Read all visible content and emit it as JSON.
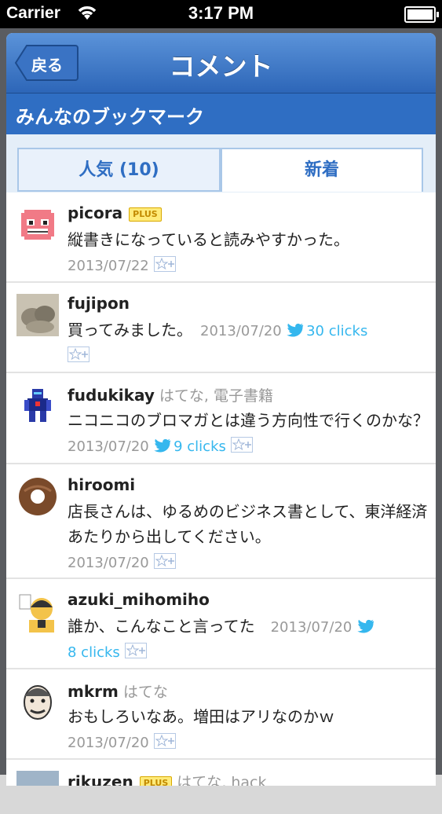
{
  "status_bar": {
    "carrier": "Carrier",
    "time": "3:17 PM"
  },
  "nav": {
    "back_label": "戻る",
    "title": "コメント"
  },
  "section_title": "みんなのブックマーク",
  "tabs": [
    {
      "label": "人気 (10)"
    },
    {
      "label": "新着"
    }
  ],
  "comments": [
    {
      "user": "picora",
      "badge": "PLUS",
      "tags": "",
      "text": "縦書きになっていると読みやすかった。",
      "date": "2013/07/22",
      "clicks": ""
    },
    {
      "user": "fujipon",
      "badge": "",
      "tags": "",
      "text": "買ってみました。",
      "date": "2013/07/20",
      "clicks": "30 clicks"
    },
    {
      "user": "fudukikay",
      "badge": "",
      "tags": "はてな, 電子書籍",
      "text": "ニコニコのブロマガとは違う方向性で行くのかな？",
      "date": "2013/07/20",
      "clicks": "9 clicks"
    },
    {
      "user": "hiroomi",
      "badge": "",
      "tags": "",
      "text": "店長さんは、ゆるめのビジネス書として、東洋経済あたりから出してください。",
      "date": "2013/07/20",
      "clicks": ""
    },
    {
      "user": "azuki_mihomiho",
      "badge": "",
      "tags": "",
      "text": "誰か、こんなこと言ってた",
      "date": "2013/07/20",
      "clicks": "8 clicks"
    },
    {
      "user": "mkrm",
      "badge": "",
      "tags": "はてな",
      "text": "おもしろいなあ。増田はアリなのかｗ",
      "date": "2013/07/20",
      "clicks": ""
    },
    {
      "user": "rikuzen",
      "badge": "PLUS",
      "tags": "はてな, hack",
      "text": "",
      "date": "",
      "clicks": ""
    }
  ],
  "colors": {
    "nav_blue": "#2d66b8",
    "section_blue": "#2f6ec3",
    "twitter": "#35b7ee",
    "meta_gray": "#999999"
  }
}
